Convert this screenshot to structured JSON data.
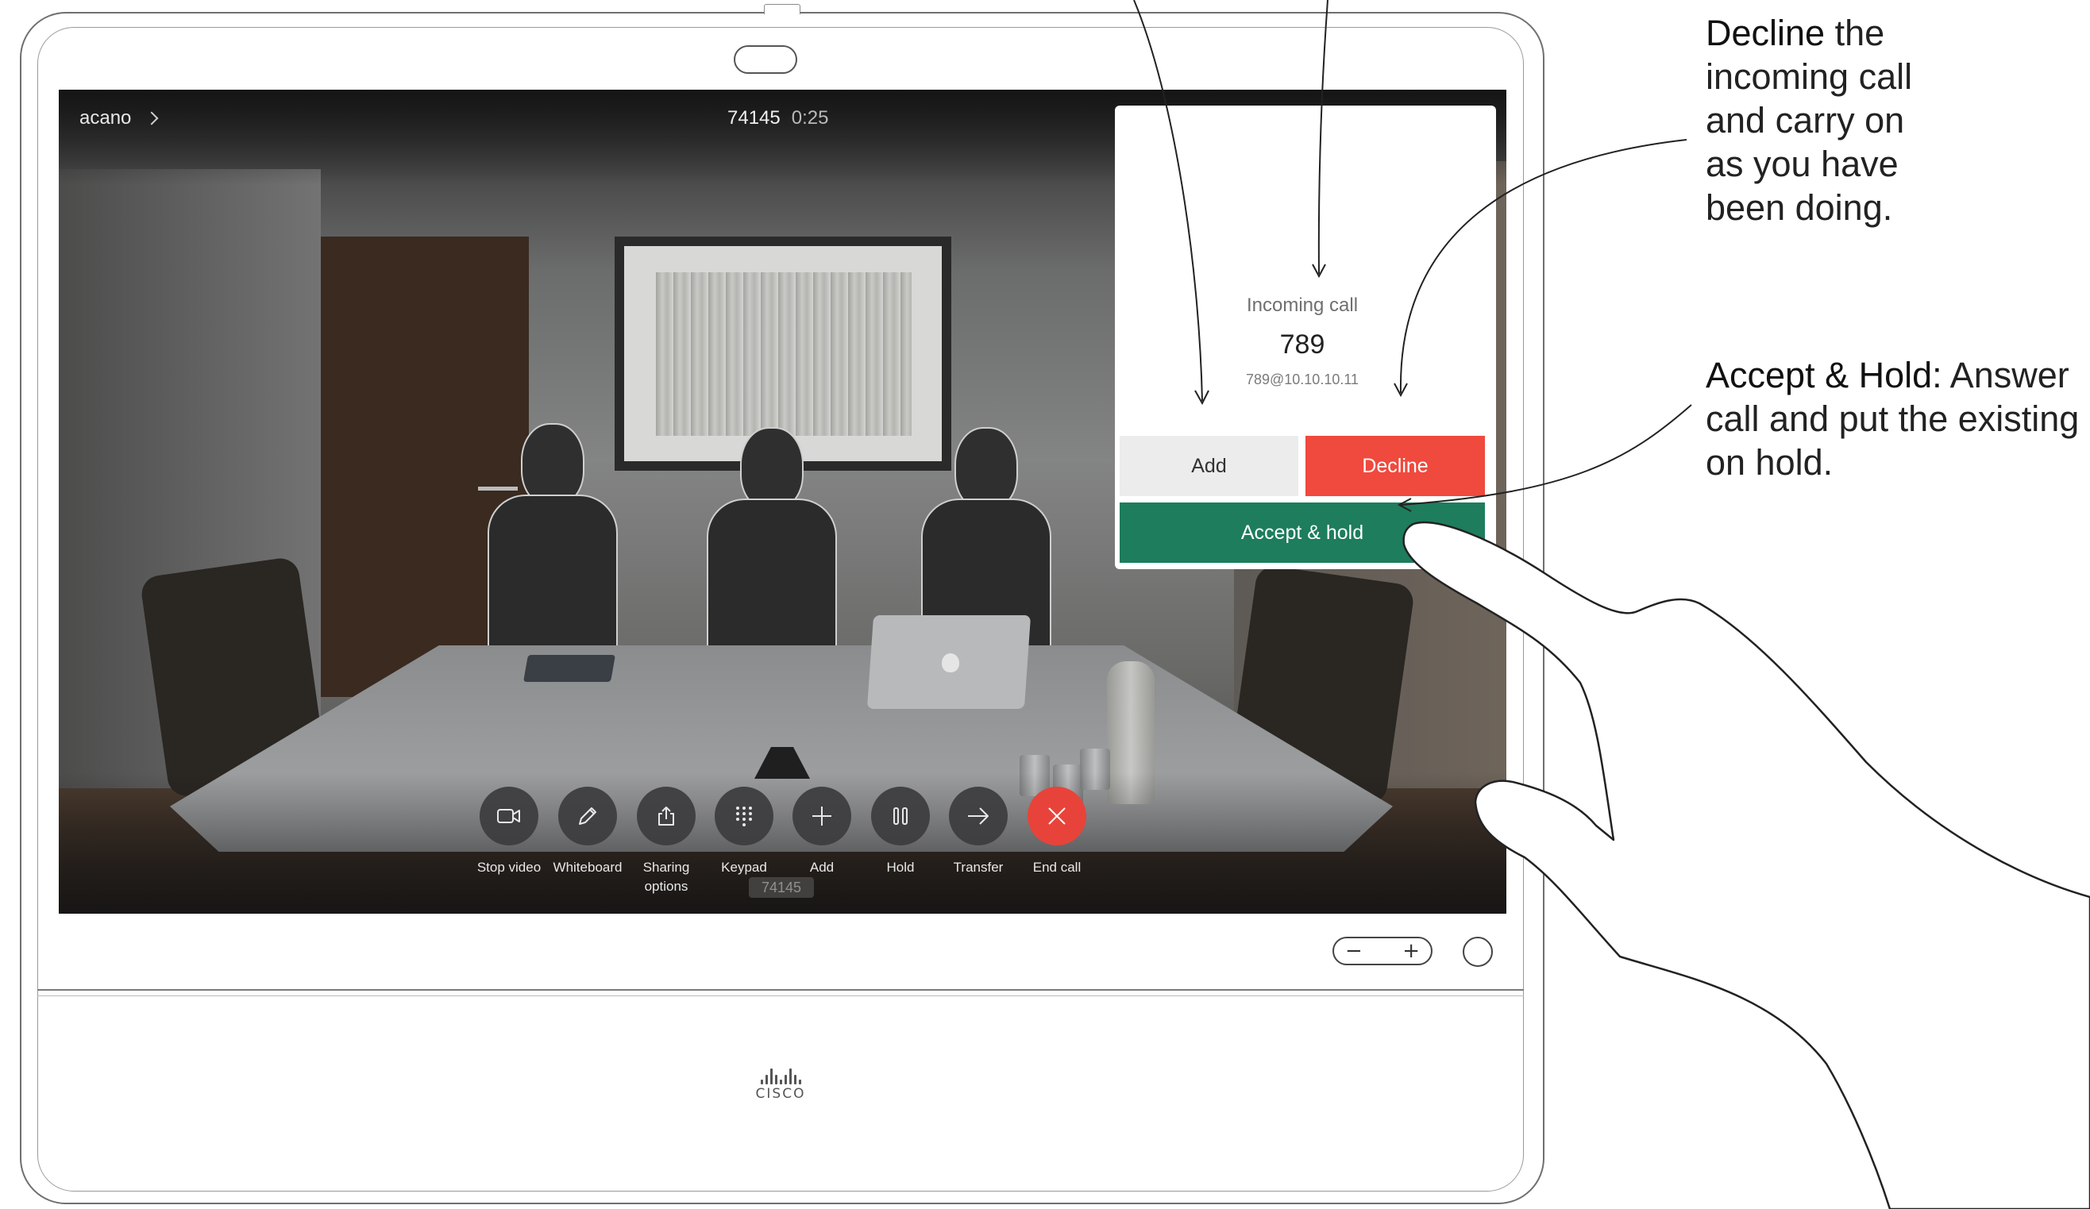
{
  "top_bar": {
    "site_name": "acano",
    "call_number": "74145",
    "call_timer": "0:25"
  },
  "incoming_call": {
    "title": "Incoming call",
    "caller_number": "789",
    "caller_uri": "789@10.10.10.11",
    "add_label": "Add",
    "decline_label": "Decline",
    "accept_hold_label": "Accept & hold",
    "colors": {
      "decline": "#f0493e",
      "accept_hold": "#1d7d5c",
      "add": "#ececec"
    }
  },
  "toolbar": {
    "buttons": [
      {
        "label": "Stop video",
        "icon": "camera-icon"
      },
      {
        "label": "Whiteboard",
        "icon": "pencil-icon"
      },
      {
        "label": "Sharing\noptions",
        "icon": "share-icon"
      },
      {
        "label": "Keypad",
        "icon": "keypad-icon"
      },
      {
        "label": "Add",
        "icon": "plus-icon"
      },
      {
        "label": "Hold",
        "icon": "pause-icon"
      },
      {
        "label": "Transfer",
        "icon": "arrow-right-icon"
      },
      {
        "label": "End call",
        "icon": "close-icon"
      }
    ],
    "keypad_chip": "74145",
    "end_call_color": "#e8433a"
  },
  "device": {
    "volume_minus": "−",
    "volume_plus": "+",
    "brand": "CISCO"
  },
  "annotations": {
    "decline_bold": "Decline",
    "decline_rest_line1": " the",
    "decline_line2": "incoming call",
    "decline_line3": "and carry on",
    "decline_line4": "as you have",
    "decline_line5": "been doing.",
    "accept_bold": "Accept & Hold:",
    "accept_rest_line1": " Answer",
    "accept_line2": "call and put the existing",
    "accept_line3": "on hold."
  }
}
